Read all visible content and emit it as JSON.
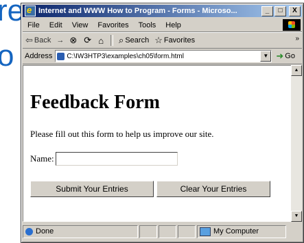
{
  "background_slide": {
    "line1": "re",
    "line2": "o"
  },
  "window": {
    "title": "Internet and WWW How to Program - Forms - Microso...",
    "controls": {
      "minimize": "_",
      "maximize": "□",
      "close": "X"
    }
  },
  "menubar": {
    "items": [
      "File",
      "Edit",
      "View",
      "Favorites",
      "Tools",
      "Help"
    ]
  },
  "toolbar": {
    "back": "Back",
    "forward": "→",
    "search": "Search",
    "favorites": "Favorites",
    "more": "»"
  },
  "address": {
    "label": "Address",
    "value": "C:\\IW3HTP3\\examples\\ch05\\form.html",
    "go": "Go"
  },
  "page": {
    "title": "Feedback Form",
    "intro": "Please fill out this form to help us improve our site.",
    "name_label": "Name:",
    "name_value": "",
    "submit_label": "Submit Your Entries",
    "clear_label": "Clear Your Entries"
  },
  "statusbar": {
    "status": "Done",
    "zone": "My Computer"
  }
}
